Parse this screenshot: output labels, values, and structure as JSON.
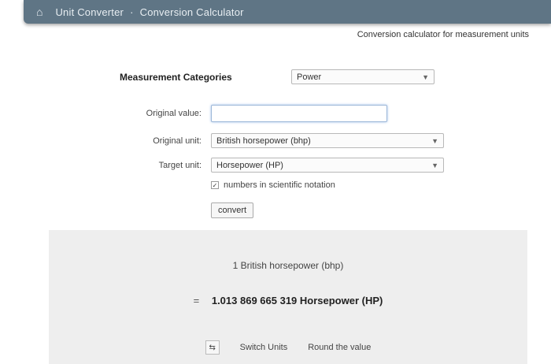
{
  "header": {
    "home_icon": "home-icon",
    "title": "Unit Converter",
    "separator": "·",
    "section": "Conversion Calculator"
  },
  "subtitle": "Conversion calculator for measurement units",
  "form": {
    "category_label": "Measurement Categories",
    "category_value": "Power",
    "original_value_label": "Original value:",
    "original_value": "",
    "original_unit_label": "Original unit:",
    "original_unit_value": "British horsepower (bhp)",
    "target_unit_label": "Target unit:",
    "target_unit_value": "Horsepower (HP)",
    "checkbox_label": "numbers in scientific notation",
    "convert_label": "convert"
  },
  "result": {
    "from_text": "1 British horsepower (bhp)",
    "equals_sign": "=",
    "to_text": "1.013 869 665 319 Horsepower (HP)",
    "action_icon": "swap-icon",
    "action_1": "Switch Units",
    "action_2": "Round the value"
  }
}
